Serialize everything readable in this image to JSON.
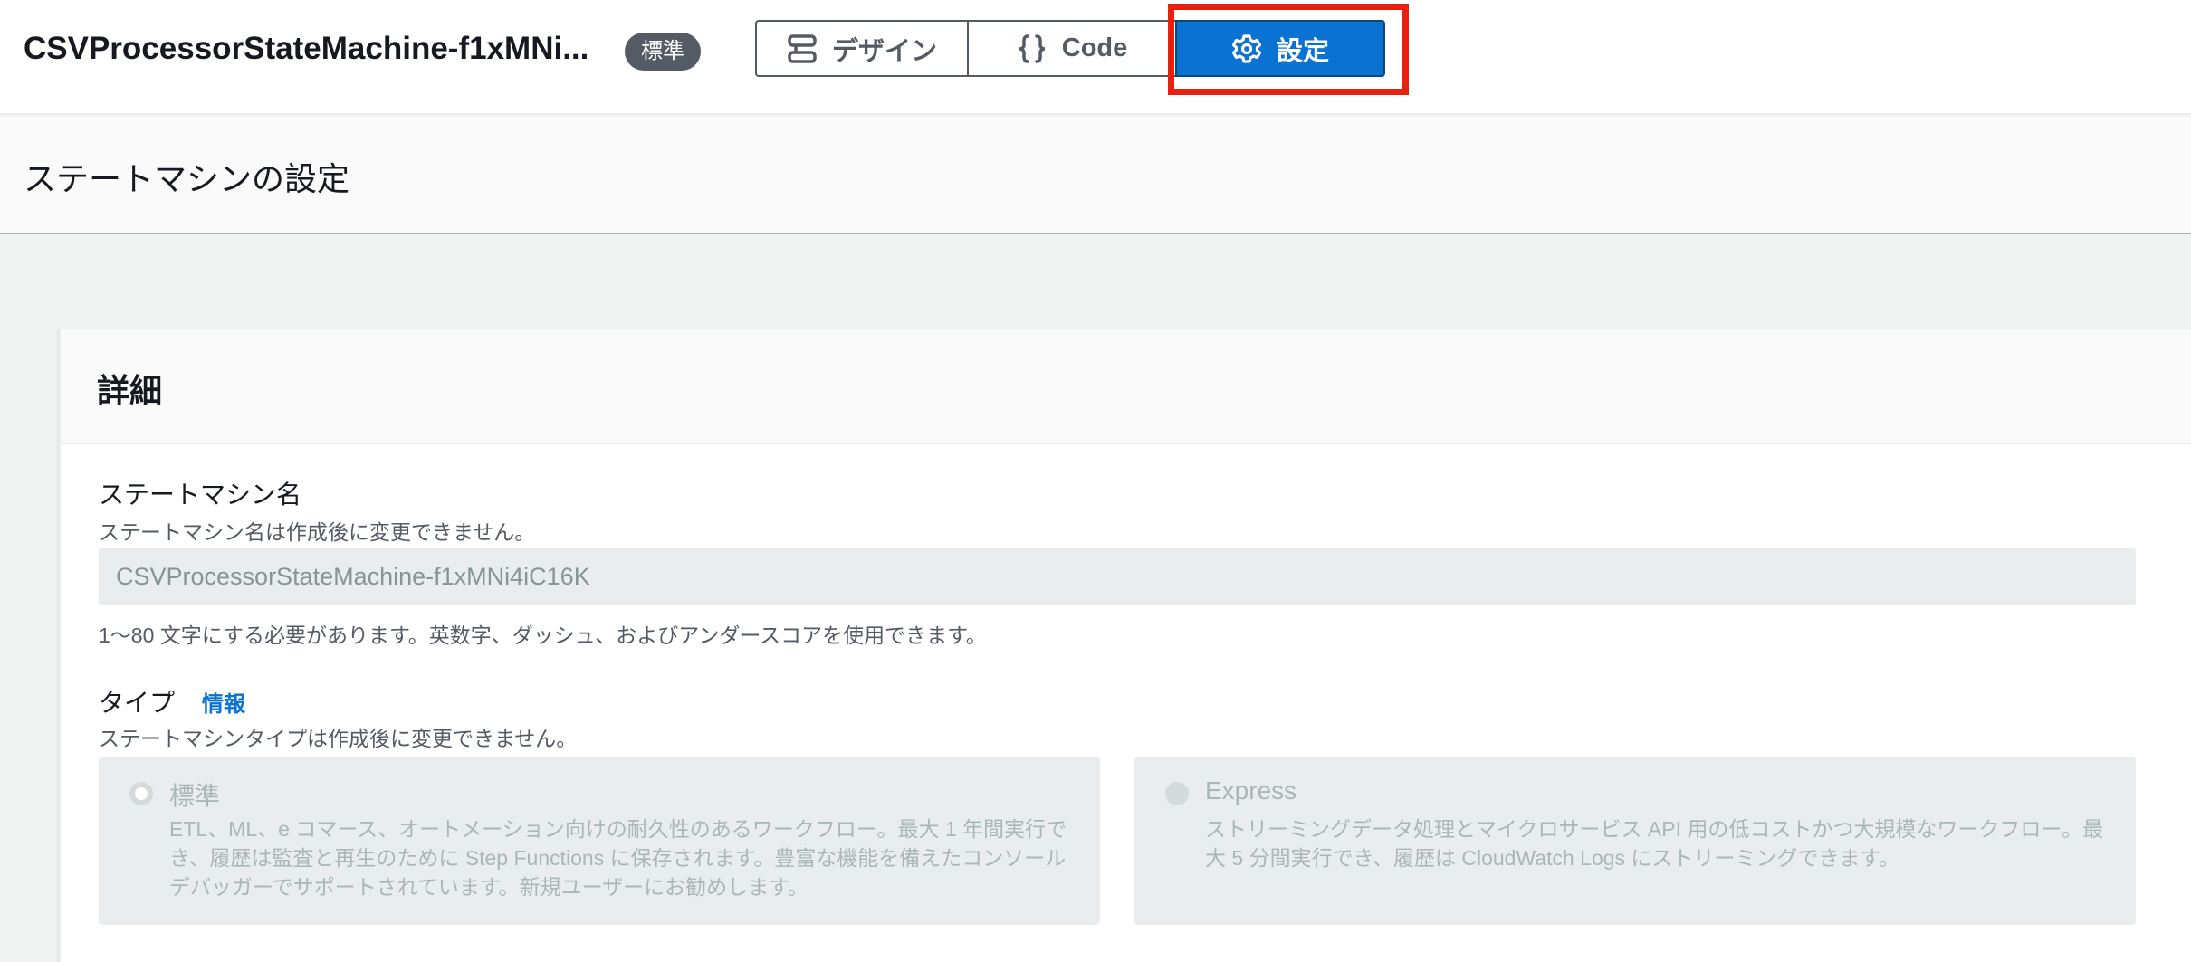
{
  "header": {
    "title": "CSVProcessorStateMachine-f1xMNi...",
    "type_badge": "標準",
    "tabs": [
      {
        "label": "デザイン",
        "icon": "design-flow-icon",
        "selected": false
      },
      {
        "label": "Code",
        "icon": "braces-icon",
        "selected": false
      },
      {
        "label": "設定",
        "icon": "gear-icon",
        "selected": true
      }
    ]
  },
  "page": {
    "title": "ステートマシンの設定"
  },
  "details": {
    "heading": "詳細",
    "name_field": {
      "label": "ステートマシン名",
      "description": "ステートマシン名は作成後に変更できません。",
      "value": "CSVProcessorStateMachine-f1xMNi4iC16K",
      "constraint": "1〜80 文字にする必要があります。英数字、ダッシュ、およびアンダースコアを使用できます。"
    },
    "type_field": {
      "label": "タイプ",
      "info_link": "情報",
      "description": "ステートマシンタイプは作成後に変更できません。",
      "options": [
        {
          "title": "標準",
          "selected": true,
          "description": "ETL、ML、e コマース、オートメーション向けの耐久性のあるワークフロー。最大 1 年間実行でき、履歴は監査と再生のために Step Functions に保存されます。豊富な機能を備えたコンソールデバッガーでサポートされています。新規ユーザーにお勧めします。"
        },
        {
          "title": "Express",
          "selected": false,
          "description": "ストリーミングデータ処理とマイクロサービス API 用の低コストかつ大規模なワークフロー。最大 5 分間実行でき、履歴は CloudWatch Logs にストリーミングできます。"
        }
      ]
    }
  },
  "colors": {
    "accent": "#0972d3",
    "highlight_box": "#e8200e",
    "badge": "#545b64"
  }
}
